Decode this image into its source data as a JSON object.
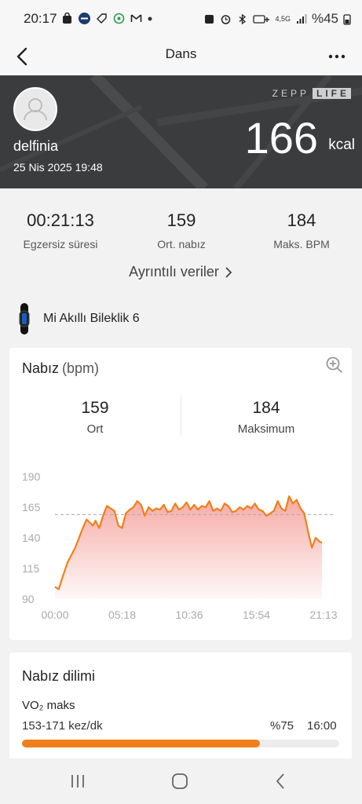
{
  "status_bar": {
    "time": "20:17",
    "network": "4,5G",
    "battery": "%45",
    "icons": [
      "shopping-bag-icon",
      "mavi-app-icon",
      "tag-icon",
      "whatsapp-icon",
      "gmail-icon",
      "dot-icon",
      "notification-icon",
      "alarm-icon",
      "bluetooth-icon",
      "hd-plus-icon",
      "signal-icon",
      "battery-icon"
    ]
  },
  "app_bar": {
    "title": "Dans",
    "back_icon": "back-arrow-icon",
    "more_icon": "more-icon"
  },
  "hero": {
    "username": "delfinia",
    "datetime": "25 Nis 2025 19:48",
    "brand_left": "ZEPP",
    "brand_right": "LIFE",
    "calories": "166",
    "calories_unit": "kcal"
  },
  "stats": [
    {
      "value": "00:21:13",
      "label": "Egzersiz süresi"
    },
    {
      "value": "159",
      "label": "Ort. nabız"
    },
    {
      "value": "184",
      "label": "Maks. BPM"
    }
  ],
  "details_link": "Ayrıntılı veriler",
  "device": {
    "name": "Mi Akıllı Bileklik 6"
  },
  "heart_rate": {
    "title": "Nabız",
    "unit": "(bpm)",
    "avg_value": "159",
    "avg_label": "Ort",
    "max_value": "184",
    "max_label": "Maksimum"
  },
  "chart_data": {
    "type": "area",
    "ylim": [
      90,
      190
    ],
    "yticks": [
      "190",
      "165",
      "140",
      "115",
      "90"
    ],
    "xticks": [
      "00:00",
      "05:18",
      "10:36",
      "15:54",
      "21:13"
    ],
    "x_range_min": [
      0,
      21.22
    ],
    "average_line": 159,
    "line_color": "#f07f1b",
    "fill_color": "#f5a5a0",
    "series": [
      {
        "x": [
          0,
          0.3,
          0.6,
          1.0,
          1.3,
          1.6,
          1.9,
          2.2,
          2.5,
          2.8,
          3.0,
          3.2,
          3.5,
          3.8,
          4.1,
          4.4,
          4.7,
          5.0,
          5.3,
          5.6,
          5.9,
          6.2,
          6.5,
          6.8,
          7.1,
          7.4,
          7.7,
          8.0,
          8.3,
          8.6,
          8.9,
          9.2,
          9.5,
          9.8,
          10.1,
          10.4,
          10.7,
          11.0,
          11.3,
          11.6,
          11.9,
          12.2,
          12.5,
          12.8,
          13.1,
          13.4,
          13.7,
          14.0,
          14.3,
          14.6,
          14.9,
          15.2,
          15.5,
          15.8,
          16.1,
          16.4,
          16.7,
          17.0,
          17.3,
          17.6,
          17.9,
          18.2,
          18.5,
          18.8,
          19.1,
          19.4,
          19.7,
          20.0,
          20.3,
          20.6,
          20.9,
          21.1
        ],
        "y": [
          100,
          98,
          108,
          120,
          126,
          132,
          140,
          148,
          155,
          152,
          150,
          154,
          148,
          158,
          166,
          164,
          162,
          150,
          148,
          160,
          163,
          165,
          170,
          167,
          158,
          165,
          162,
          164,
          163,
          167,
          161,
          162,
          168,
          163,
          165,
          169,
          163,
          167,
          163,
          166,
          165,
          170,
          162,
          164,
          162,
          168,
          166,
          161,
          162,
          165,
          163,
          166,
          164,
          168,
          163,
          162,
          158,
          160,
          162,
          170,
          164,
          162,
          174,
          168,
          171,
          164,
          160,
          145,
          132,
          140,
          137,
          136
        ]
      }
    ]
  },
  "zones": {
    "title": "Nabız dilimi",
    "zone_name": "VO₂ maks",
    "range": "153-171 kez/dk",
    "percent": "%75",
    "time": "16:00",
    "fill_ratio": 0.75
  },
  "nav_bar": {
    "icons": [
      "recent-apps-icon",
      "home-icon",
      "back-icon"
    ]
  }
}
